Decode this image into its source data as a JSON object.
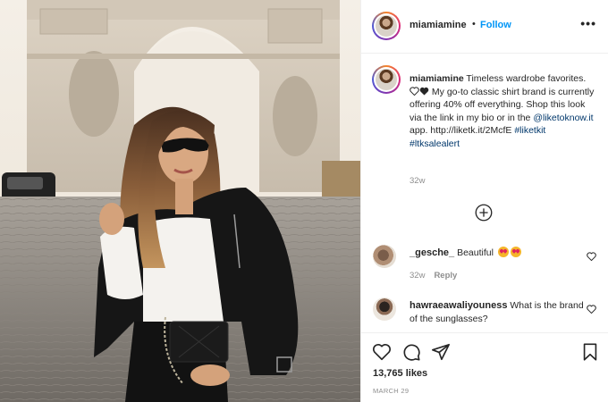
{
  "post": {
    "username": "miamiamine",
    "follow_label": "Follow",
    "separator": "•",
    "more_label": "•••",
    "caption": {
      "username": "miamiamine",
      "text_1": " Timeless wardrobe favorites. ",
      "text_2": " My go-to classic shirt brand is currently offering 40% off everything. Shop this look via the link in my bio or in the ",
      "mention": "@liketoknow.it",
      "text_3": " app. http://liketk.it/2McfE ",
      "hashtag_1": "#liketkit",
      "hashtag_2": "#ltksalealert"
    },
    "caption_time": "32w",
    "likes_label": "13,765 likes",
    "date_label": "MARCH 29"
  },
  "comments": [
    {
      "username": "_gesche_",
      "text": " Beautiful ",
      "time": "32w",
      "reply_label": "Reply"
    },
    {
      "username": "hawraeawaliyouness",
      "text": " What is the brand of the sunglasses?"
    }
  ],
  "icons": {
    "like": "heart-icon",
    "comment": "comment-bubble-icon",
    "share": "paper-plane-icon",
    "save": "bookmark-icon",
    "load_more": "plus-circle-icon",
    "emoji": "heart-eyes-emoji-icon"
  },
  "colors": {
    "accent": "#0095f6",
    "link": "#00376b",
    "muted": "#8e8e8e",
    "text": "#262626"
  }
}
